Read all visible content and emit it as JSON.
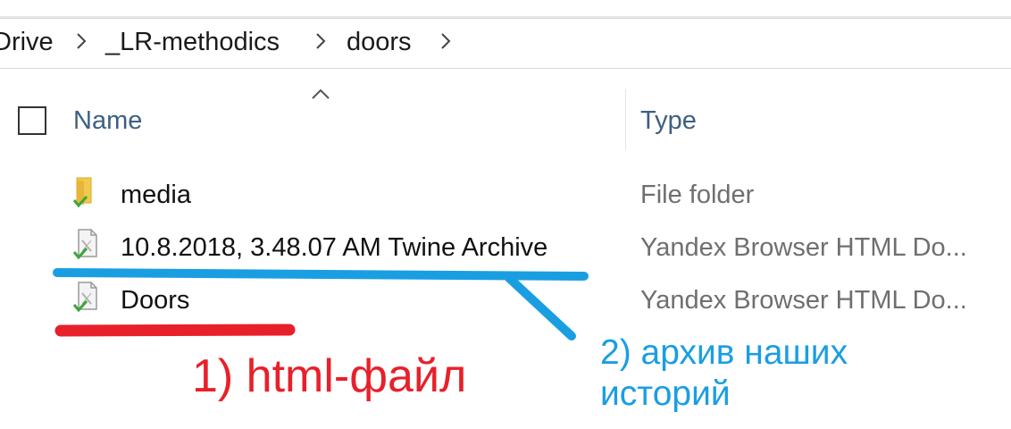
{
  "breadcrumb": {
    "items": [
      "Drive",
      "_LR-methodics",
      "doors"
    ]
  },
  "columns": {
    "name": "Name",
    "type": "Type"
  },
  "files": [
    {
      "name": "media",
      "type": "File folder",
      "icon": "folder-icon"
    },
    {
      "name": "10.8.2018, 3.48.07 AM Twine Archive",
      "type": "Yandex Browser HTML Do...",
      "icon": "html-file-icon"
    },
    {
      "name": "Doors",
      "type": "Yandex Browser HTML Do...",
      "icon": "html-file-icon"
    }
  ],
  "annotations": {
    "red_label": "1) html-файл",
    "blue_label_line1": "2) архив наших",
    "blue_label_line2": "историй"
  },
  "colors": {
    "annotation_red": "#e8202a",
    "annotation_blue": "#1a9ee2",
    "header_text": "#3e5f80",
    "sync_check": "#3aa63a",
    "folder": "#f2c94c"
  }
}
